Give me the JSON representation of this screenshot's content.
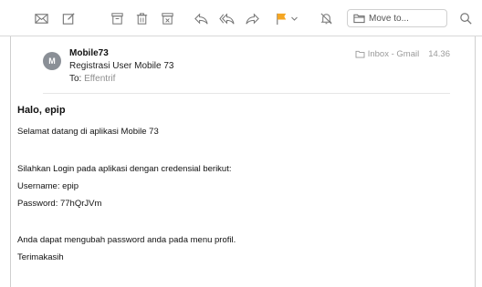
{
  "toolbar": {
    "icons": [
      "envelope-icon",
      "compose-icon",
      "archive-icon",
      "trash-icon",
      "junk-icon",
      "reply-icon",
      "reply-all-icon",
      "forward-icon",
      "flag-icon",
      "chevron-down-icon",
      "mute-bell-icon",
      "folder-icon",
      "search-icon"
    ],
    "move_to_label": "Move to...",
    "flag_color": "#f5a623"
  },
  "message": {
    "avatar_letter": "M",
    "sender": "Mobile73",
    "subject": "Registrasi User Mobile 73",
    "to_label": "To:",
    "to_value": "Effentrif",
    "mailbox": "Inbox - Gmail",
    "time": "14.36"
  },
  "content": {
    "greeting": "Halo, epip",
    "welcome": "Selamat datang di aplikasi Mobile 73",
    "instruction": "Silahkan Login pada aplikasi dengan credensial berikut:",
    "username": "Username: epip",
    "password": "Password: 77hQrJVm",
    "note": "Anda dapat mengubah password anda pada menu profil.",
    "closing": "Terimakasih"
  }
}
